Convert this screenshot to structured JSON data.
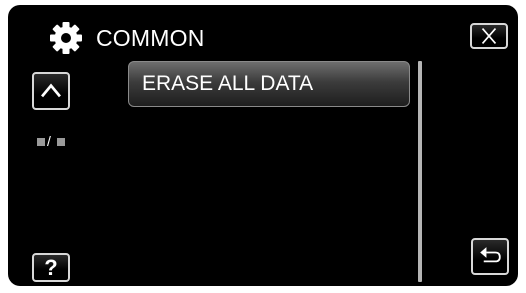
{
  "header": {
    "title": "COMMON",
    "icon": "gear-icon"
  },
  "menu": {
    "items": [
      {
        "label": "ERASE ALL DATA"
      }
    ]
  },
  "buttons": {
    "close_icon": "close-icon",
    "up_icon": "chevron-up-icon",
    "help_label": "?",
    "back_icon": "return-icon"
  },
  "page_indicator": {
    "separator": "/"
  },
  "colors": {
    "background": "#000000",
    "text": "#ffffff",
    "menu_item_top": "#6e6e6e",
    "menu_item_bottom": "#1e1e1e",
    "button_border": "#d8d8d8"
  }
}
